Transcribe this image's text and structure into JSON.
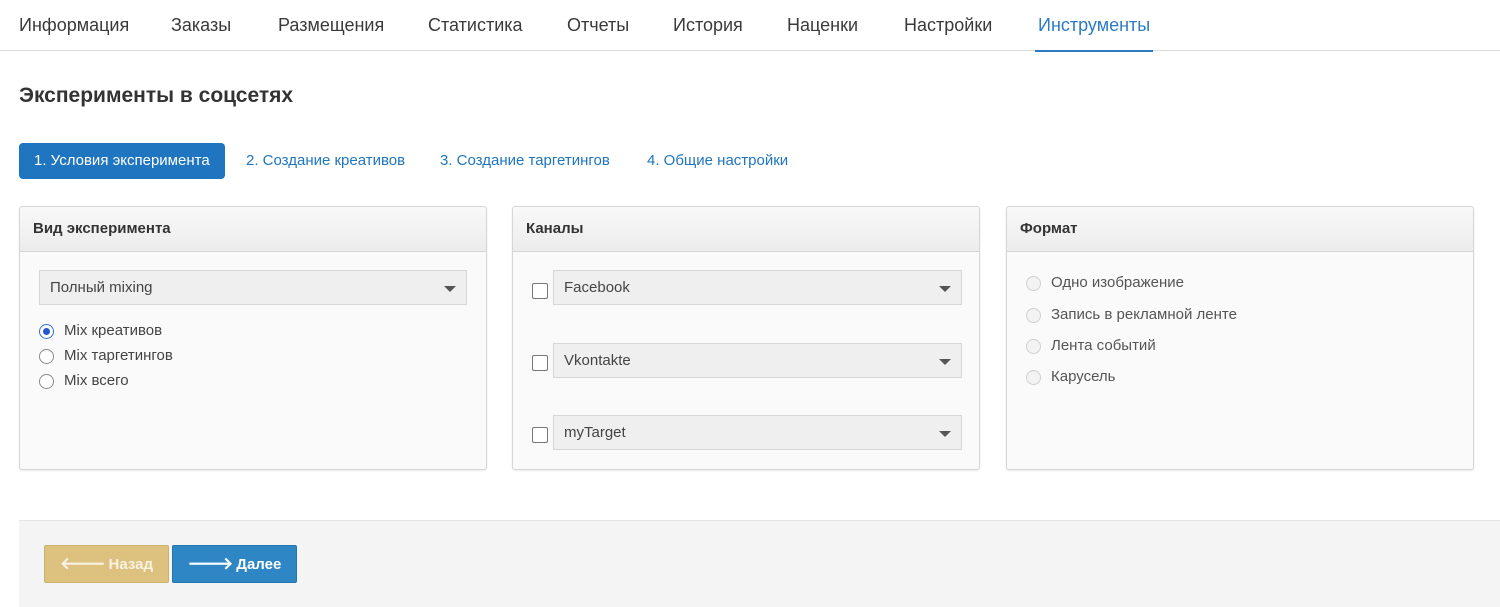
{
  "tabs": [
    {
      "label": "Информация"
    },
    {
      "label": "Заказы"
    },
    {
      "label": "Размещения"
    },
    {
      "label": "Статистика"
    },
    {
      "label": "Отчеты"
    },
    {
      "label": "История"
    },
    {
      "label": "Наценки"
    },
    {
      "label": "Настройки"
    },
    {
      "label": "Инструменты",
      "active": true
    }
  ],
  "page": {
    "title": "Эксперименты в соцсетях"
  },
  "steps": [
    {
      "label": "1. Условия эксперимента",
      "active": true
    },
    {
      "label": "2. Создание креативов"
    },
    {
      "label": "3. Создание таргетингов"
    },
    {
      "label": "4. Общие настройки"
    }
  ],
  "experiment_type": {
    "title": "Вид эксперимента",
    "select_value": "Полный mixing",
    "options": [
      {
        "label": "Mix креативов",
        "checked": true
      },
      {
        "label": "Mix таргетингов",
        "checked": false
      },
      {
        "label": "Mix всего",
        "checked": false
      }
    ]
  },
  "channels": {
    "title": "Каналы",
    "items": [
      {
        "label": "Facebook",
        "checked": false
      },
      {
        "label": "Vkontakte",
        "checked": false
      },
      {
        "label": "myTarget",
        "checked": false
      }
    ]
  },
  "format": {
    "title": "Формат",
    "options": [
      {
        "label": "Одно изображение",
        "disabled": true
      },
      {
        "label": "Запись в рекламной ленте",
        "disabled": true
      },
      {
        "label": "Лента событий",
        "disabled": true
      },
      {
        "label": "Карусель",
        "disabled": true
      }
    ]
  },
  "footer": {
    "back_label": "Назад",
    "next_label": "Далее",
    "back_icon": "arrow-left-icon",
    "next_icon": "arrow-right-icon"
  },
  "colors": {
    "accent": "#1f75c0",
    "back_button": "#dcc17f",
    "next_button": "#2f86c4"
  }
}
